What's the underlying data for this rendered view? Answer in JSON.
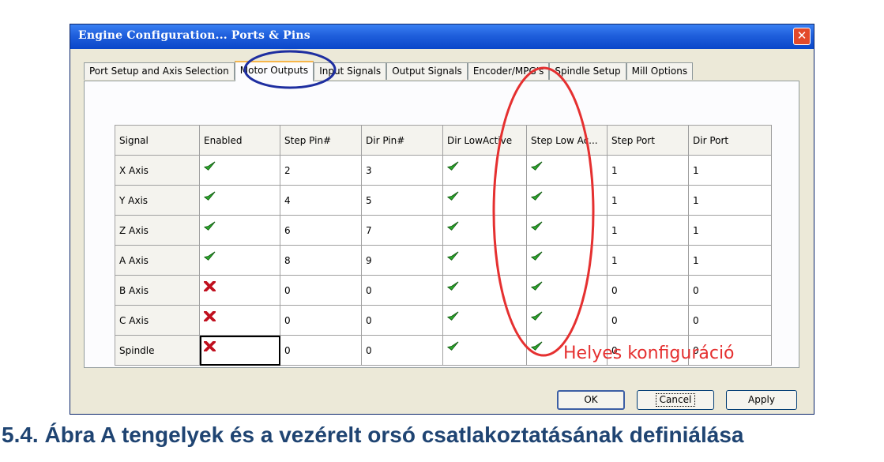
{
  "dialog": {
    "title": "Engine Configuration... Ports & Pins",
    "close_glyph": "✕"
  },
  "tabs": [
    {
      "label": "Port Setup and Axis Selection",
      "active": false
    },
    {
      "label": "Motor Outputs",
      "active": true
    },
    {
      "label": "Input Signals",
      "active": false
    },
    {
      "label": "Output Signals",
      "active": false
    },
    {
      "label": "Encoder/MPG's",
      "active": false
    },
    {
      "label": "Spindle Setup",
      "active": false
    },
    {
      "label": "Mill Options",
      "active": false
    }
  ],
  "table": {
    "headers": [
      "Signal",
      "Enabled",
      "Step Pin#",
      "Dir Pin#",
      "Dir LowActive",
      "Step Low Ac...",
      "Step Port",
      "Dir Port"
    ],
    "rows": [
      {
        "signal": "X Axis",
        "enabled": true,
        "step_pin": "2",
        "dir_pin": "3",
        "dir_low_active": true,
        "step_low_active": true,
        "step_port": "1",
        "dir_port": "1"
      },
      {
        "signal": "Y Axis",
        "enabled": true,
        "step_pin": "4",
        "dir_pin": "5",
        "dir_low_active": true,
        "step_low_active": true,
        "step_port": "1",
        "dir_port": "1"
      },
      {
        "signal": "Z Axis",
        "enabled": true,
        "step_pin": "6",
        "dir_pin": "7",
        "dir_low_active": true,
        "step_low_active": true,
        "step_port": "1",
        "dir_port": "1"
      },
      {
        "signal": "A Axis",
        "enabled": true,
        "step_pin": "8",
        "dir_pin": "9",
        "dir_low_active": true,
        "step_low_active": true,
        "step_port": "1",
        "dir_port": "1"
      },
      {
        "signal": "B Axis",
        "enabled": false,
        "step_pin": "0",
        "dir_pin": "0",
        "dir_low_active": true,
        "step_low_active": true,
        "step_port": "0",
        "dir_port": "0"
      },
      {
        "signal": "C Axis",
        "enabled": false,
        "step_pin": "0",
        "dir_pin": "0",
        "dir_low_active": true,
        "step_low_active": true,
        "step_port": "0",
        "dir_port": "0"
      },
      {
        "signal": "Spindle",
        "enabled": false,
        "step_pin": "0",
        "dir_pin": "0",
        "dir_low_active": true,
        "step_low_active": true,
        "step_port": "0",
        "dir_port": "0"
      }
    ]
  },
  "buttons": {
    "ok": "OK",
    "cancel": "Cancel",
    "apply": "Apply"
  },
  "annotation": {
    "label": "Helyes konfiguráció",
    "oval_color": "#e53030",
    "circle_color": "#1e2ea0"
  },
  "caption": "5.4. Ábra  A tengelyek és a vezérelt orsó csatlakoztatásának definiálása",
  "icons": {
    "check": "green-check-icon",
    "cross": "red-x-icon"
  }
}
